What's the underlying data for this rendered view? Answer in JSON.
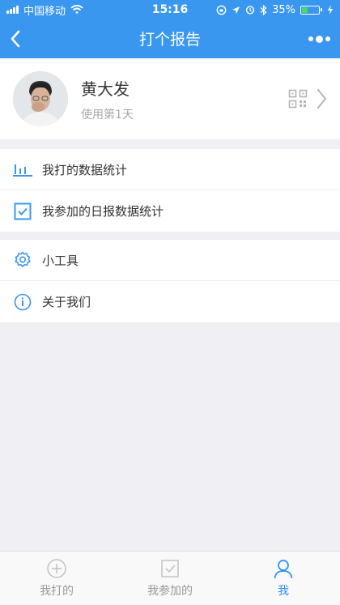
{
  "status": {
    "carrier": "中国移动",
    "time": "15:16",
    "battery": "35%",
    "battery_level": 0.35
  },
  "nav": {
    "title": "打个报告",
    "back_icon": "chevron-left-icon",
    "more_icon": "more-dots-icon"
  },
  "profile": {
    "name": "黄大发",
    "subtitle": "使用第1天",
    "qr_icon": "qr-code-icon",
    "arrow_icon": "chevron-right-icon"
  },
  "menu_group1": [
    {
      "label": "我打的数据统计",
      "icon": "bar-chart-icon"
    },
    {
      "label": "我参加的日报数据统计",
      "icon": "checkbox-icon"
    }
  ],
  "menu_group2": [
    {
      "label": "小工具",
      "icon": "gear-icon"
    },
    {
      "label": "关于我们",
      "icon": "info-icon"
    }
  ],
  "tabs": [
    {
      "label": "我打的",
      "icon": "plus-circle-icon",
      "active": false
    },
    {
      "label": "我参加的",
      "icon": "check-square-icon",
      "active": false
    },
    {
      "label": "我",
      "icon": "user-icon",
      "active": true
    }
  ],
  "colors": {
    "primary": "#3a97f0",
    "active_tab": "#2f8ff0",
    "background": "#efeff4"
  }
}
